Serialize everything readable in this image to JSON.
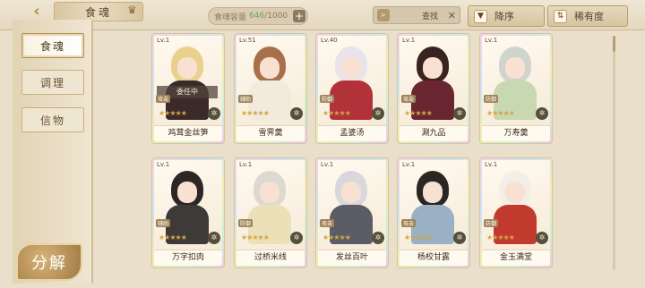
{
  "header": {
    "title": "食魂",
    "capacity_label": "食魂容量",
    "capacity_current": "646",
    "capacity_max": "/1000",
    "search_placeholder": "查找",
    "sort_label": "降序",
    "rarity_label": "稀有度"
  },
  "sidebar": {
    "tabs": [
      {
        "label": "食魂",
        "active": true
      },
      {
        "label": "调理",
        "active": false
      },
      {
        "label": "信物",
        "active": false
      }
    ],
    "decompose_label": "分解"
  },
  "cards": [
    {
      "level": "Lv.1",
      "name": "鸡茸金丝笋",
      "badge": "攻击",
      "status": "委任中",
      "hair": "#e9d18c",
      "outfit": "#3b2a2a"
    },
    {
      "level": "Lv.51",
      "name": "雪霁羹",
      "badge": "辅助",
      "status": "",
      "hair": "#a8704a",
      "outfit": "#f2eadc"
    },
    {
      "level": "Lv.40",
      "name": "孟婆汤",
      "badge": "防御",
      "status": "",
      "hair": "#e8e4ea",
      "outfit": "#b2323a"
    },
    {
      "level": "Lv.1",
      "name": "涮九品",
      "badge": "攻击",
      "status": "",
      "hair": "#3a2220",
      "outfit": "#6a2630"
    },
    {
      "level": "Lv.1",
      "name": "万寿羹",
      "badge": "防御",
      "status": "",
      "hair": "#cfd4cc",
      "outfit": "#c8d8b0"
    },
    {
      "level": "Lv.1",
      "name": "万字扣肉",
      "badge": "辅助",
      "status": "",
      "hair": "#2e2624",
      "outfit": "#3e3a38"
    },
    {
      "level": "Lv.1",
      "name": "过桥米线",
      "badge": "防御",
      "status": "",
      "hair": "#dcdad0",
      "outfit": "#ece0b8"
    },
    {
      "level": "Lv.1",
      "name": "发丝百叶",
      "badge": "攻击",
      "status": "",
      "hair": "#d8d8dc",
      "outfit": "#5c5c66"
    },
    {
      "level": "Lv.1",
      "name": "杨校甘露",
      "badge": "攻击",
      "status": "",
      "hair": "#2a2622",
      "outfit": "#9ab0c4"
    },
    {
      "level": "Lv.1",
      "name": "金玉满堂",
      "badge": "防御",
      "status": "",
      "hair": "#f3efe8",
      "outfit": "#c23a2e"
    }
  ]
}
